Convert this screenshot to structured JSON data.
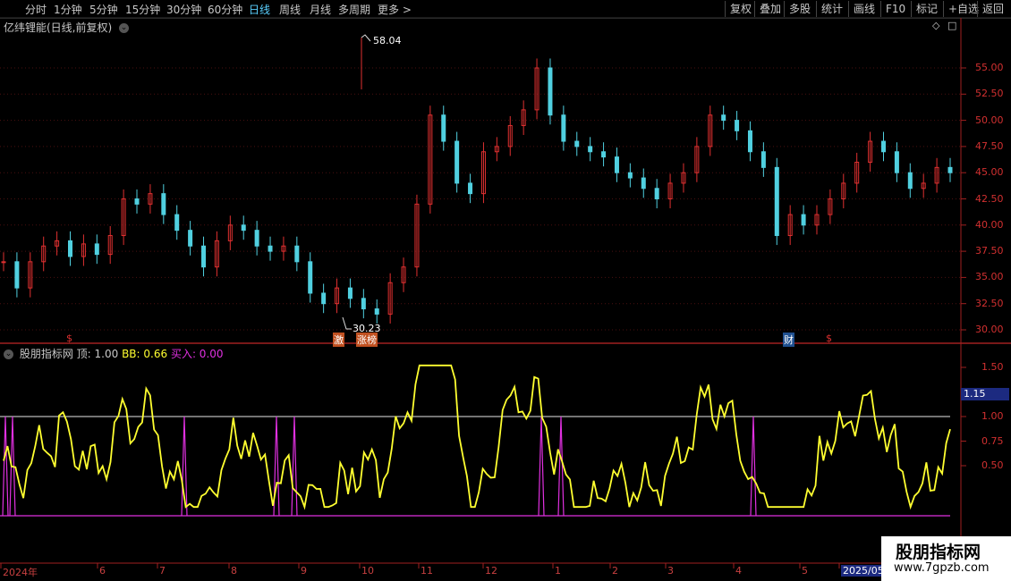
{
  "toolbar": {
    "periods": [
      {
        "label": "分时",
        "active": false
      },
      {
        "label": "1分钟",
        "active": false
      },
      {
        "label": "5分钟",
        "active": false
      },
      {
        "label": "15分钟",
        "active": false
      },
      {
        "label": "30分钟",
        "active": false
      },
      {
        "label": "60分钟",
        "active": false
      },
      {
        "label": "日线",
        "active": true
      },
      {
        "label": "周线",
        "active": false
      },
      {
        "label": "月线",
        "active": false
      },
      {
        "label": "多周期",
        "active": false
      },
      {
        "label": "更多 >",
        "active": false
      }
    ],
    "right_buttons": [
      "复权",
      "叠加",
      "多股",
      "统计",
      "画线",
      "F10",
      "标记",
      "+自选",
      "返回"
    ]
  },
  "main_chart": {
    "title": "亿纬锂能(日线,前复权)",
    "high_label": "58.04",
    "low_label": "30.23",
    "price_axis": [
      "55.00",
      "52.50",
      "50.00",
      "47.50",
      "45.00",
      "42.50",
      "40.00",
      "37.50",
      "35.00",
      "32.50",
      "30.00"
    ],
    "markers": [
      {
        "text": "$",
        "color": "#e03030"
      },
      {
        "text": "激",
        "color": "#ffffff",
        "bg": "#c05020"
      },
      {
        "text": "涨榜",
        "color": "#ffffff",
        "bg": "#c05020"
      },
      {
        "text": "财",
        "color": "#ffffff",
        "bg": "#205090"
      },
      {
        "text": "$",
        "color": "#e03030"
      }
    ]
  },
  "indicator": {
    "name": "股朋指标网",
    "top_label": "顶: 1.00",
    "bb_label": "BB: 0.66",
    "buy_label": "买入: 0.00",
    "axis": [
      "1.50",
      "1.25",
      "1.00",
      "0.75",
      "0.50"
    ],
    "current_value": "1.15"
  },
  "time_axis": [
    "2024年",
    "6",
    "7",
    "8",
    "9",
    "10",
    "11",
    "12",
    "1",
    "2",
    "3",
    "4",
    "5",
    "2025/05"
  ],
  "watermark": {
    "title": "股朋指标网",
    "url": "www.7gpzb.com"
  },
  "colors": {
    "up": "#e03030",
    "down": "#50d0e0",
    "yellow": "#ffff30",
    "magenta": "#e030e0",
    "accent": "#5ad0ff"
  },
  "chart_data": {
    "type": "candlestick",
    "ticker_title": "亿纬锂能(日线,前复权)",
    "approx_closes": [
      36.5,
      34.0,
      36.5,
      38.0,
      38.5,
      37.0,
      38.2,
      37.2,
      39.0,
      42.5,
      42.0,
      43.0,
      41.0,
      39.5,
      38.0,
      36.0,
      38.5,
      40.0,
      39.5,
      38.0,
      37.5,
      38.0,
      36.5,
      33.5,
      32.5,
      34.0,
      33.0,
      32.0,
      31.5,
      34.5,
      36.0,
      42.0,
      50.5,
      48.0,
      44.0,
      43.0,
      47.0,
      47.5,
      49.5,
      51.0,
      55.0,
      50.5,
      48.0,
      47.5,
      47.0,
      46.5,
      45.0,
      44.5,
      43.5,
      42.5,
      44.0,
      45.0,
      47.5,
      50.5,
      50.0,
      49.0,
      47.0,
      45.5,
      39.0,
      41.0,
      40.0,
      41.0,
      42.5,
      44.0,
      46.0,
      48.0,
      47.0,
      45.0,
      43.5,
      44.0,
      45.5,
      45.0
    ],
    "high": 58.04,
    "low": 30.23,
    "y_axis_range": [
      30.0,
      57.0
    ]
  }
}
